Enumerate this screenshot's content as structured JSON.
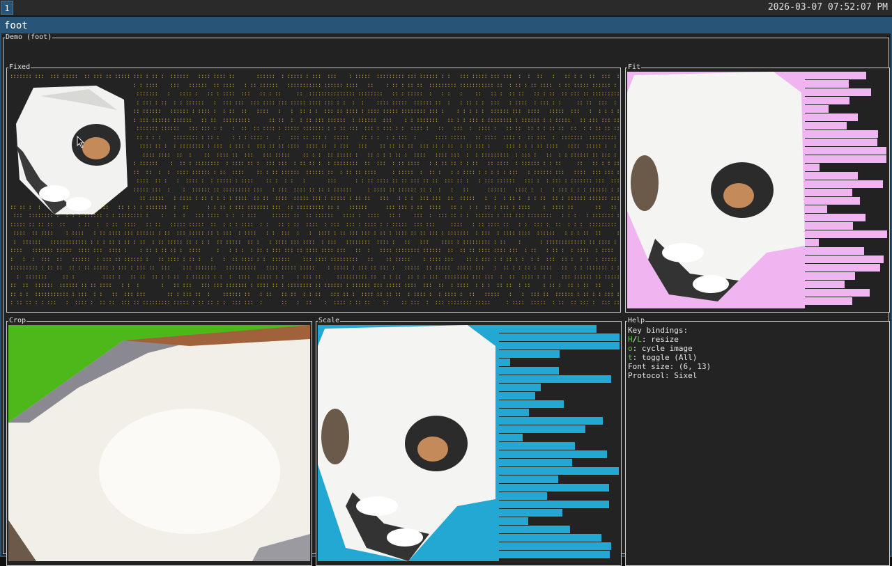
{
  "topbar": {
    "workspace": "1",
    "clock": "2026-03-07 07:52:07 PM"
  },
  "window": {
    "title": "foot"
  },
  "demo": {
    "title": "Demo (foot)",
    "panels": {
      "fixed": "Fixed",
      "fit": "Fit",
      "crop": "Crop",
      "scale": "Scale",
      "help": "Help"
    }
  },
  "help": {
    "heading": "Key bindings:",
    "bindings": [
      {
        "key_a": "H",
        "sep": "/",
        "key_b": "L",
        "desc": ": resize"
      },
      {
        "key_a": "o",
        "desc": ": cycle image"
      },
      {
        "key_a": "t",
        "desc": ": toggle (All)"
      }
    ],
    "font_size": "Font size: (6, 13)",
    "protocol": "Protocol: Sixel"
  },
  "colors": {
    "accent": "#285577",
    "fit_bg": "#f0b4f0",
    "crop_bg": "#4db81a",
    "scale_bg": "#23a8d4",
    "dot_color": "#c9a227"
  },
  "icons": {
    "pointer": "mouse-pointer-icon"
  }
}
